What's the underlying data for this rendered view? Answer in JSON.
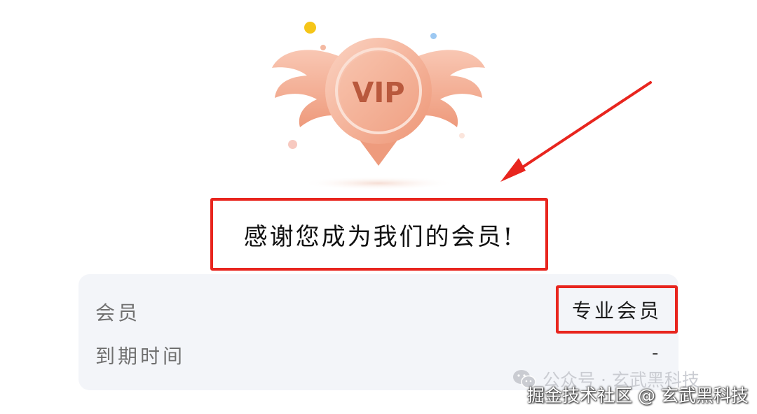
{
  "badge": {
    "vip_text": "VIP"
  },
  "thanks": {
    "message": "感谢您成为我们的会员!"
  },
  "membership": {
    "member_label": "会员",
    "member_value": "专业会员",
    "expire_label": "到期时间",
    "expire_value": "-"
  },
  "watermarks": {
    "wechat_public": "公众号 · 玄武黑科技",
    "juejin": "掘金技术社区 @ 玄武黑科技"
  },
  "colors": {
    "highlight_red": "#e8251e",
    "badge_peach": "#f2a98c",
    "card_bg": "#f3f5f9"
  }
}
